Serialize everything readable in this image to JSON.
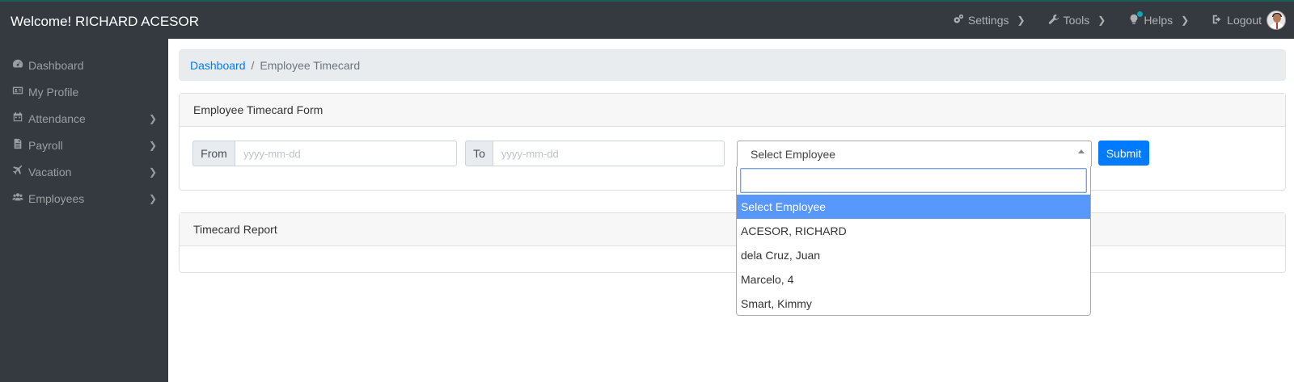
{
  "header": {
    "title": "Welcome! RICHARD ACESOR",
    "nav": [
      {
        "label": "Settings",
        "icon": "cogs-icon"
      },
      {
        "label": "Tools",
        "icon": "wrench-icon"
      },
      {
        "label": "Helps",
        "icon": "lightbulb-icon"
      },
      {
        "label": "Logout",
        "icon": "sign-out-icon"
      }
    ]
  },
  "sidebar": {
    "items": [
      {
        "label": "Dashboard",
        "icon": "dashboard-icon",
        "has_submenu": false
      },
      {
        "label": "My Profile",
        "icon": "id-card-icon",
        "has_submenu": false
      },
      {
        "label": "Attendance",
        "icon": "calendar-icon",
        "has_submenu": true
      },
      {
        "label": "Payroll",
        "icon": "file-icon",
        "has_submenu": true
      },
      {
        "label": "Vacation",
        "icon": "plane-icon",
        "has_submenu": true
      },
      {
        "label": "Employees",
        "icon": "users-icon",
        "has_submenu": true
      }
    ]
  },
  "breadcrumb": {
    "home": "Dashboard",
    "separator": "/",
    "current": "Employee Timecard"
  },
  "form": {
    "title": "Employee Timecard Form",
    "from_label": "From",
    "from_placeholder": "yyyy-mm-dd",
    "to_label": "To",
    "to_placeholder": "yyyy-mm-dd",
    "employee_select": {
      "selected": "Select Employee",
      "search_value": "",
      "options": [
        "Select Employee",
        "ACESOR, RICHARD",
        "dela Cruz, Juan",
        "Marcelo, 4",
        "Smart, Kimmy"
      ],
      "highlighted_index": 0
    },
    "submit_label": "Submit"
  },
  "report": {
    "title": "Timecard Report"
  },
  "colors": {
    "topbar": "#343a40",
    "primary": "#007bff",
    "highlight": "#5897fb"
  }
}
